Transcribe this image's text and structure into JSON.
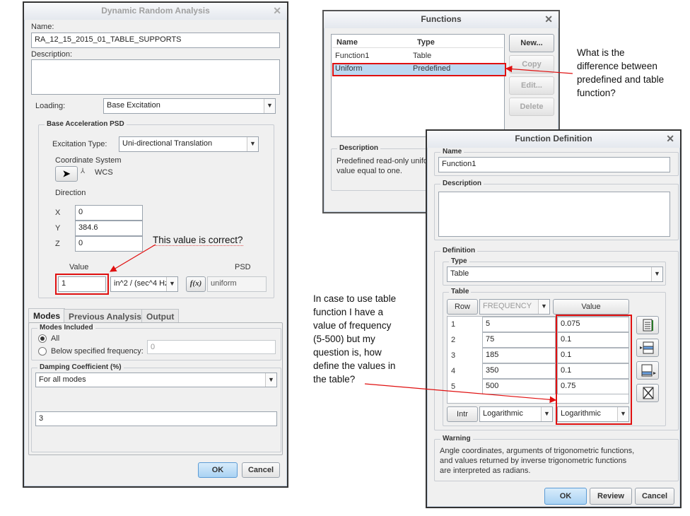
{
  "dra": {
    "title": "Dynamic Random Analysis",
    "name_label": "Name:",
    "name_value": "RA_12_15_2015_01_TABLE_SUPPORTS",
    "description_label": "Description:",
    "loading_label": "Loading:",
    "loading_value": "Base Excitation",
    "bap_group": "Base Acceleration PSD",
    "excitation_label": "Excitation Type:",
    "excitation_value": "Uni-directional Translation",
    "coord_label": "Coordinate System",
    "wcs_label": "WCS",
    "direction_label": "Direction",
    "x_label": "X",
    "x_value": "0",
    "y_label": "Y",
    "y_value": "384.6",
    "z_label": "Z",
    "z_value": "0",
    "value_label": "Value",
    "psd_label": "PSD",
    "value_value": "1",
    "units_value": "in^2 / (sec^4 Hz",
    "fx_label": "f(x)",
    "psd_value": "uniform",
    "tabs": [
      "Modes",
      "Previous Analysis",
      "Output"
    ],
    "modes_group": "Modes Included",
    "all_label": "All",
    "below_label": "Below specified frequency:",
    "below_value": "0",
    "damping_group": "Damping Coefficient (%)",
    "damping_mode": "For all modes",
    "damping_value": "3",
    "ok": "OK",
    "cancel": "Cancel"
  },
  "functions": {
    "title": "Functions",
    "col_name": "Name",
    "col_type": "Type",
    "rows": [
      {
        "name": "Function1",
        "type": "Table"
      },
      {
        "name": "Uniform",
        "type": "Predefined"
      }
    ],
    "new": "New...",
    "copy": "Copy",
    "edit": "Edit...",
    "delete": "Delete",
    "desc_group": "Description",
    "desc_text_1": "Predefined read-only unifo",
    "desc_text_2": "value equal to one."
  },
  "fdef": {
    "title": "Function Definition",
    "name_group": "Name",
    "name_value": "Function1",
    "desc_group": "Description",
    "def_group": "Definition",
    "type_group": "Type",
    "type_value": "Table",
    "table_group": "Table",
    "col_row": "Row",
    "col_freq": "FREQUENCY",
    "col_value": "Value",
    "rows": [
      {
        "row": "1",
        "freq": "5",
        "value": "0.075"
      },
      {
        "row": "2",
        "freq": "75",
        "value": "0.1"
      },
      {
        "row": "3",
        "freq": "185",
        "value": "0.1"
      },
      {
        "row": "4",
        "freq": "350",
        "value": "0.1"
      },
      {
        "row": "5",
        "freq": "500",
        "value": "0.75"
      }
    ],
    "intr_label": "Intr",
    "intr_freq": "Logarithmic",
    "intr_value": "Logarithmic",
    "warning_group": "Warning",
    "warning_1": "Angle coordinates, arguments of trigonometric functions,",
    "warning_2": "and values returned by inverse trigonometric functions",
    "warning_3": "are interpreted as radians.",
    "ok": "OK",
    "review": "Review",
    "cancel": "Cancel"
  },
  "notes": {
    "q1_a": "What is the",
    "q1_b": "difference between",
    "q1_c": "predefined and table",
    "q1_d": "function?",
    "q2": "This value is correct?",
    "q3_1": "In case to use table",
    "q3_2": "function I have a",
    "q3_3": "value of frequency",
    "q3_4": "(5-500) but my",
    "q3_5": "question is, how",
    "q3_6": "define the values in",
    "q3_7": "the table?"
  },
  "colors": {
    "annotation": "#e01010",
    "selection": "#bcd9f2",
    "ok_button": "#a9d2f3"
  }
}
